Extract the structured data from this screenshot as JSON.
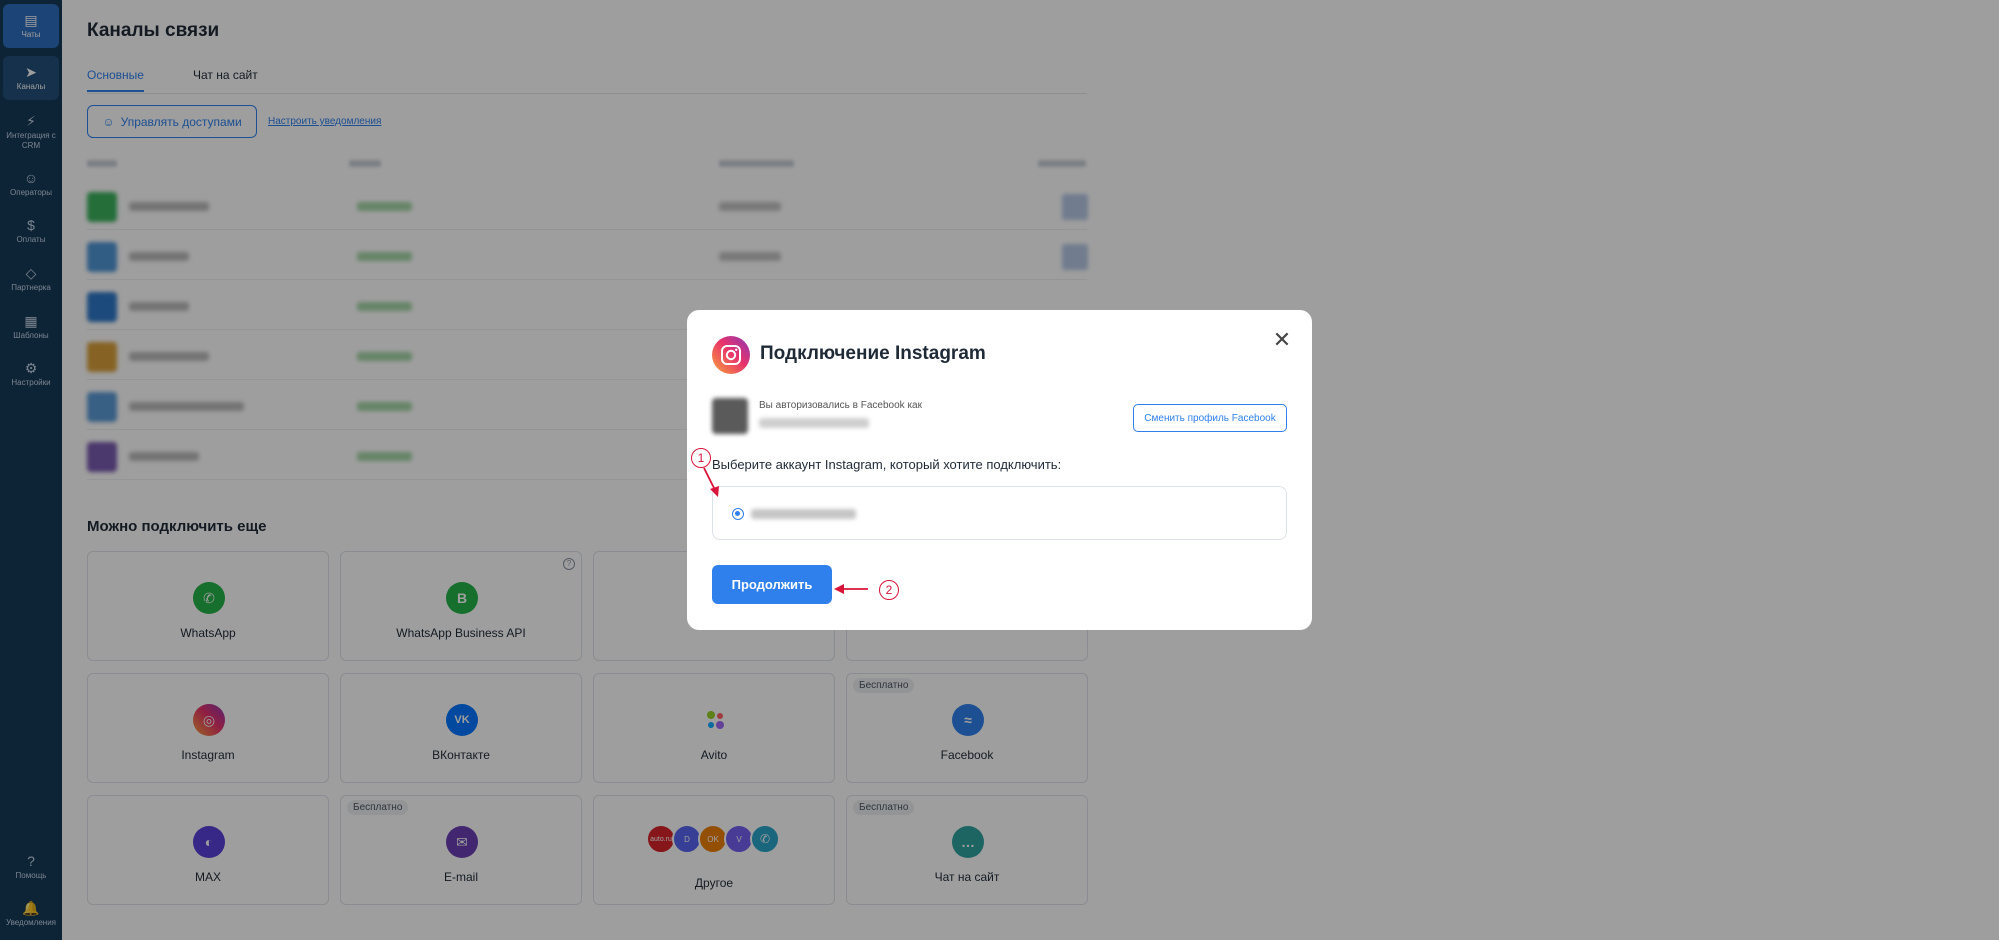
{
  "sidebar": {
    "items": [
      {
        "label": "Чаты",
        "icon": "chats-icon",
        "glyph": "▤"
      },
      {
        "label": "Каналы",
        "icon": "send-icon",
        "glyph": "➤"
      },
      {
        "label": "Интеграция с CRM",
        "icon": "plug-icon",
        "glyph": "⚡"
      },
      {
        "label": "Операторы",
        "icon": "users-icon",
        "glyph": "☺"
      },
      {
        "label": "Оплаты",
        "icon": "dollar-icon",
        "glyph": "$"
      },
      {
        "label": "Партнерка",
        "icon": "diamond-icon",
        "glyph": "◇"
      },
      {
        "label": "Шаблоны",
        "icon": "template-icon",
        "glyph": "▦"
      },
      {
        "label": "Настройки",
        "icon": "gear-icon",
        "glyph": "⚙"
      }
    ],
    "help": {
      "label": "Помощь",
      "glyph": "?"
    },
    "notifications": {
      "label": "Уведомления",
      "glyph": "🔔"
    }
  },
  "main": {
    "title": "Каналы связи",
    "tabs": [
      {
        "label": "Основные"
      },
      {
        "label": "Чат на сайт"
      }
    ],
    "manage_access_label": "Управлять доступами",
    "notify_link": "Настроить уведомления",
    "section_title": "Можно подключить еще",
    "cards": [
      {
        "label": "WhatsApp",
        "color": "#25b34a",
        "glyph": "✆"
      },
      {
        "label": "WhatsApp Business API",
        "color": "#25b34a",
        "glyph": "B"
      },
      {
        "label": "Instagram",
        "color": "#e1306c",
        "glyph": "◎"
      },
      {
        "label": "ВКонтакте",
        "color": "#0077ff",
        "glyph": "VK"
      },
      {
        "label": "Avito",
        "color": "#ffffff",
        "glyph": "●"
      },
      {
        "label": "Facebook",
        "badge": "Бесплатно",
        "color": "#2f80ed",
        "glyph": "≈"
      },
      {
        "label": "MAX",
        "color": "#5a3fd8",
        "glyph": "◐"
      },
      {
        "label": "E-mail",
        "badge": "Бесплатно",
        "color": "#6b3fb5",
        "glyph": "✉"
      },
      {
        "label": "Другое",
        "color": "#ffffff",
        "glyph": ""
      },
      {
        "label": "Чат на сайт",
        "badge": "Бесплатно",
        "color": "#2fa3a0",
        "glyph": "…"
      }
    ],
    "other_icons": [
      {
        "text": "auto.ru",
        "color": "#d9252a"
      },
      {
        "text": "D",
        "color": "#5865f2"
      },
      {
        "text": "OK",
        "color": "#ee8208"
      },
      {
        "text": "V",
        "color": "#7360f2"
      },
      {
        "text": "✆",
        "color": "#2aa5c8"
      }
    ]
  },
  "modal": {
    "title": "Подключение Instagram",
    "fb_caption": "Вы авторизовались в Facebook как",
    "switch_profile_label": "Сменить профиль Facebook",
    "select_label": "Выберите аккаунт Instagram, который хотите подключить:",
    "continue_label": "Продолжить",
    "close_glyph": "✕"
  },
  "annotations": [
    {
      "label": "1"
    },
    {
      "label": "2"
    }
  ]
}
